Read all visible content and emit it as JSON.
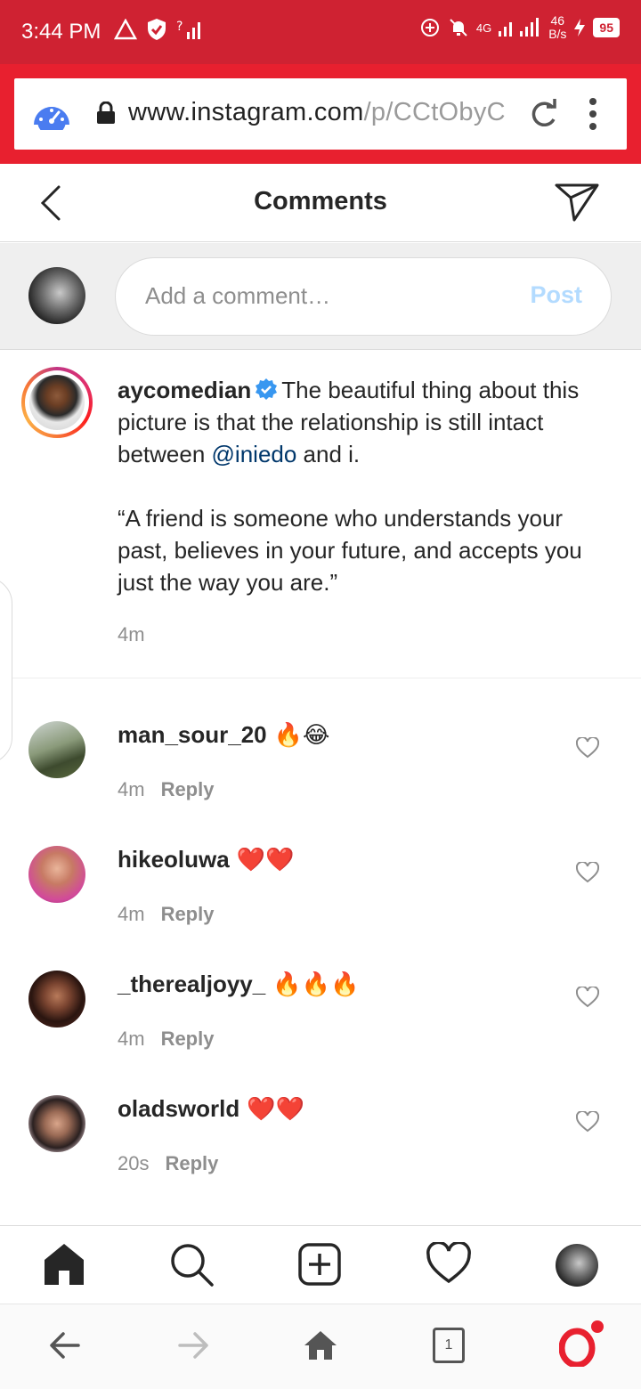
{
  "status_bar": {
    "time": "3:44 PM",
    "net_label": "4G",
    "net_speed_value": "46",
    "net_speed_unit": "B/s",
    "battery": "95"
  },
  "browser": {
    "url_host": "www.instagram.com",
    "url_path": "/p/CCtObyC"
  },
  "header": {
    "title": "Comments"
  },
  "add_comment": {
    "placeholder": "Add a comment…",
    "post_label": "Post"
  },
  "caption": {
    "username": "aycomedian",
    "text_before_mention": "The beautiful thing about this picture is that the relationship is still intact between ",
    "mention": "@iniedo",
    "text_after_mention": " and i.",
    "quote": "“A friend is someone who understands your past, believes in your future, and accepts you just the way you are.”",
    "time": "4m"
  },
  "comments": [
    {
      "username": "man_sour_20",
      "text": "🔥😂",
      "time": "4m",
      "reply": "Reply"
    },
    {
      "username": "hikeoluwa",
      "text": "❤️❤️",
      "time": "4m",
      "reply": "Reply"
    },
    {
      "username": "_therealjoyy_",
      "text": "🔥🔥🔥",
      "time": "4m",
      "reply": "Reply"
    },
    {
      "username": "oladsworld",
      "text": "❤️❤️",
      "time": "20s",
      "reply": "Reply"
    }
  ],
  "browser_nav": {
    "tab_count": "1"
  },
  "colors": {
    "status_bar": "#cf2232",
    "url_bar_frame": "#e8202f",
    "post_disabled": "#b3dbff",
    "mention": "#00376b",
    "verified": "#3897f0"
  }
}
